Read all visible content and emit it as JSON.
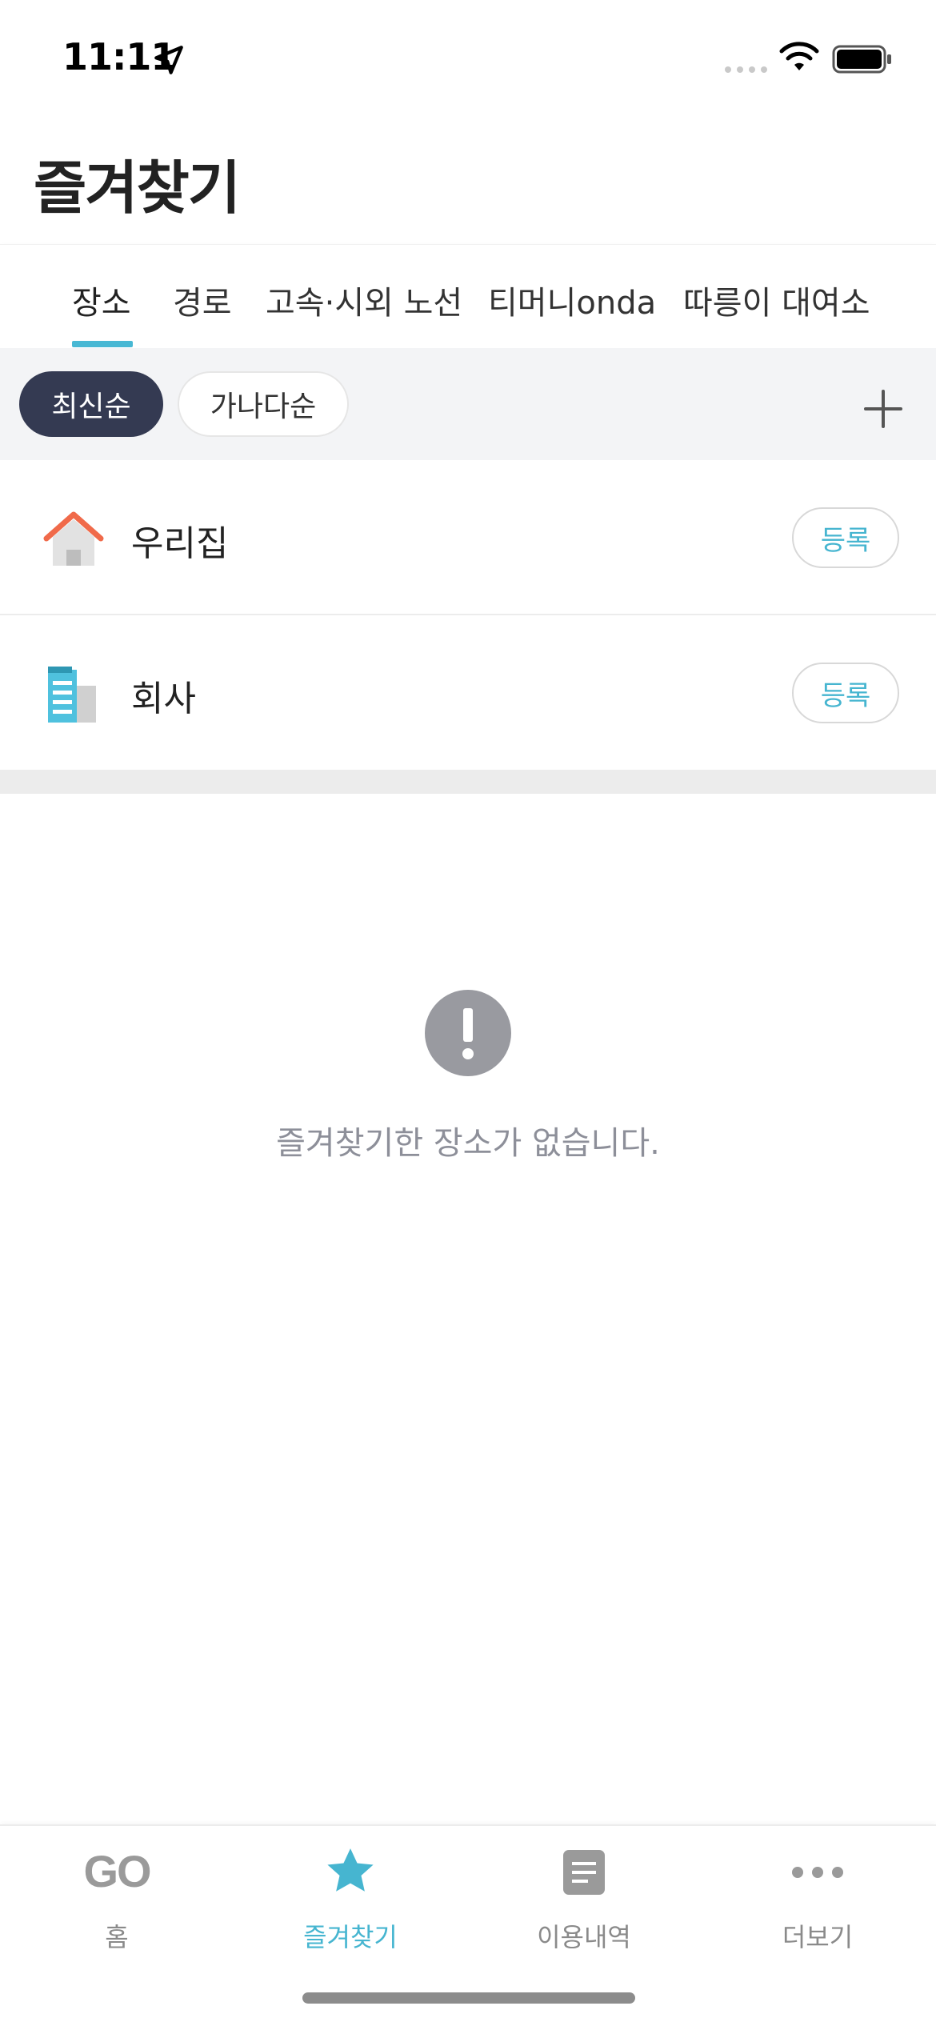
{
  "status_bar": {
    "time": "11:11"
  },
  "header": {
    "title": "즐겨찾기"
  },
  "tabs": [
    {
      "label": "장소"
    },
    {
      "label": "경로"
    },
    {
      "label": "고속·시외 노선"
    },
    {
      "label": "티머니onda"
    },
    {
      "label": "따릉이 대여소"
    }
  ],
  "sort": {
    "latest": "최신순",
    "alphabetical": "가나다순"
  },
  "places": [
    {
      "label": "우리집",
      "icon": "house-icon",
      "action": "등록"
    },
    {
      "label": "회사",
      "icon": "building-icon",
      "action": "등록"
    }
  ],
  "empty_state": {
    "message": "즐겨찾기한 장소가 없습니다."
  },
  "bottom_nav": [
    {
      "label": "홈",
      "icon": "go-logo-icon"
    },
    {
      "label": "즐겨찾기",
      "icon": "star-icon"
    },
    {
      "label": "이용내역",
      "icon": "document-icon"
    },
    {
      "label": "더보기",
      "icon": "more-icon"
    }
  ],
  "colors": {
    "accent": "#46b5d0",
    "chip_dark": "#343a52",
    "house_roof": "#f06a4a"
  }
}
